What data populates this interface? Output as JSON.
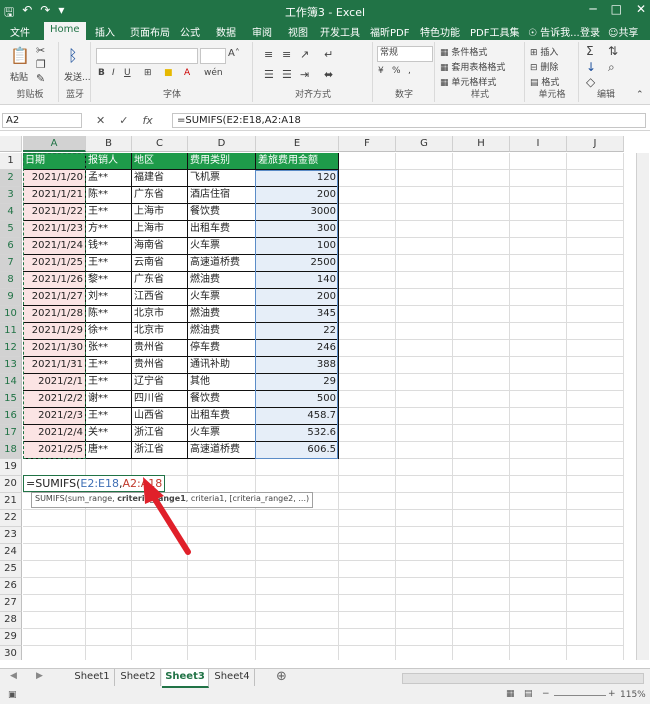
{
  "app": {
    "window_title": "工作簿3 - Excel",
    "qat": {
      "save_icon": "save-icon",
      "undo_icon": "undo-icon",
      "redo_icon": "redo-icon"
    },
    "window_buttons": [
      "─",
      "□",
      "✕"
    ]
  },
  "tabs": {
    "items": [
      "文件",
      "Home",
      "插入",
      "页面布局",
      "公式",
      "数据",
      "审阅",
      "视图",
      "开发工具",
      "福昕PDF",
      "特色功能",
      "PDF工具集"
    ],
    "active": "Home",
    "tellme": "告诉我...",
    "login": "登录",
    "share": "共享"
  },
  "ribbon": {
    "clipboard": {
      "label": "剪贴板",
      "paste": "粘贴"
    },
    "bluetooth": {
      "label": "蓝牙",
      "send": "发送..."
    },
    "font": {
      "label": "字体",
      "bold": "B",
      "italic": "I",
      "underline": "U",
      "wen": "wén"
    },
    "alignment": {
      "label": "对齐方式"
    },
    "number": {
      "label": "数字",
      "format": "常规",
      "percent": "%"
    },
    "styles": {
      "label": "样式",
      "cond": "条件格式",
      "table": "套用表格格式",
      "cell": "单元格样式"
    },
    "cells": {
      "label": "单元格",
      "insert": "插入",
      "delete": "删除",
      "format": "格式"
    },
    "editing": {
      "label": "编辑"
    }
  },
  "formula_bar": {
    "name_box": "A2",
    "cancel": "✕",
    "enter": "✓",
    "fx": "fx",
    "formula": "=SUMIFS(E2:E18,A2:A18"
  },
  "columns": [
    "A",
    "B",
    "C",
    "D",
    "E",
    "F",
    "G",
    "H",
    "I",
    "J"
  ],
  "rows": [
    "1",
    "2",
    "3",
    "4",
    "5",
    "6",
    "7",
    "8",
    "9",
    "10",
    "11",
    "12",
    "13",
    "14",
    "15",
    "16",
    "17",
    "18",
    "19",
    "20",
    "21",
    "22",
    "23",
    "24",
    "25",
    "26",
    "27",
    "28",
    "29",
    "30"
  ],
  "table": {
    "headers": [
      "日期",
      "报销人",
      "地区",
      "费用类别",
      "差旅费用金额"
    ],
    "rows": [
      [
        "2021/1/20",
        "孟**",
        "福建省",
        "飞机票",
        "120"
      ],
      [
        "2021/1/21",
        "陈**",
        "广东省",
        "酒店住宿",
        "200"
      ],
      [
        "2021/1/22",
        "王**",
        "上海市",
        "餐饮费",
        "3000"
      ],
      [
        "2021/1/23",
        "方**",
        "上海市",
        "出租车费",
        "300"
      ],
      [
        "2021/1/24",
        "钱**",
        "海南省",
        "火车票",
        "100"
      ],
      [
        "2021/1/25",
        "王**",
        "云南省",
        "高速道桥费",
        "2500"
      ],
      [
        "2021/1/26",
        "黎**",
        "广东省",
        "燃油费",
        "140"
      ],
      [
        "2021/1/27",
        "刘**",
        "江西省",
        "火车票",
        "200"
      ],
      [
        "2021/1/28",
        "陈**",
        "北京市",
        "燃油费",
        "345"
      ],
      [
        "2021/1/29",
        "徐**",
        "北京市",
        "燃油费",
        "22"
      ],
      [
        "2021/1/30",
        "张**",
        "贵州省",
        "停车费",
        "246"
      ],
      [
        "2021/1/31",
        "王**",
        "贵州省",
        "通讯补助",
        "388"
      ],
      [
        "2021/2/1",
        "王**",
        "辽宁省",
        "其他",
        "29"
      ],
      [
        "2021/2/2",
        "谢**",
        "四川省",
        "餐饮费",
        "500"
      ],
      [
        "2021/2/3",
        "王**",
        "山西省",
        "出租车费",
        "458.7"
      ],
      [
        "2021/2/4",
        "关**",
        "浙江省",
        "火车票",
        "532.6"
      ],
      [
        "2021/2/5",
        "唐**",
        "浙江省",
        "高速道桥费",
        "606.5"
      ]
    ]
  },
  "editing_cell": {
    "prefix": "=SUMIFS(",
    "arg1": "E2:E18",
    "comma": ",",
    "arg2": "A2:A18"
  },
  "tooltip": {
    "pre": "SUMIFS(sum_range, ",
    "bold": "criteria_range1",
    "post": ", criteria1, [criteria_range2, ...)"
  },
  "sheets": [
    "Sheet1",
    "Sheet2",
    "Sheet3",
    "Sheet4"
  ],
  "active_sheet": "Sheet3",
  "status": {
    "zoom": "115%",
    "minus": "−",
    "plus": "+"
  },
  "colors": {
    "excel_green": "#217346",
    "header_fill": "#1e9b4a",
    "date_fill": "#fbe4e4",
    "amount_fill": "#e6eef8",
    "arrow_red": "#e0202a",
    "range_blue": "#3f6fb5",
    "range_red": "#c0392b"
  }
}
